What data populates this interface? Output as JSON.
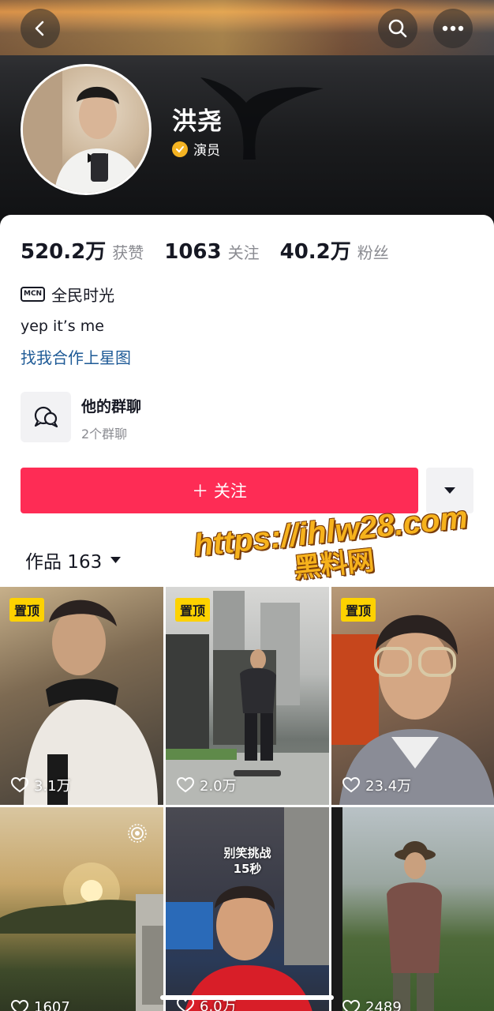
{
  "header": {
    "back_icon": "chevron-left-icon",
    "search_icon": "search-icon",
    "more_icon": "more-dots-icon",
    "name": "洪尧",
    "verify_label": "演员",
    "verify_color": "#f4b322"
  },
  "stats": [
    {
      "value": "520.2万",
      "label": "获赞"
    },
    {
      "value": "1063",
      "label": "关注"
    },
    {
      "value": "40.2万",
      "label": "粉丝"
    }
  ],
  "profile": {
    "mcn_badge": "MCN",
    "mcn_name": "全民时光",
    "bio": "yep it’s me",
    "link": "找我合作上星图"
  },
  "group_chat": {
    "title": "他的群聊",
    "subtitle": "2个群聊"
  },
  "actions": {
    "follow_label": "＋ 关注",
    "follow_color": "#fe2c55"
  },
  "works_tab": {
    "label": "作品 163"
  },
  "watermark": {
    "line1": "https://ihlw28.com",
    "line2": "黑料网"
  },
  "videos": [
    {
      "pinned": "置顶",
      "likes": "3.1万",
      "caption": ""
    },
    {
      "pinned": "置顶",
      "likes": "2.0万",
      "caption": ""
    },
    {
      "pinned": "置顶",
      "likes": "23.4万",
      "caption": ""
    },
    {
      "pinned": "",
      "likes": "1607",
      "caption": ""
    },
    {
      "pinned": "",
      "likes": "6.0万",
      "caption": "别笑挑战\n15秒"
    },
    {
      "pinned": "",
      "likes": "2489",
      "caption": ""
    }
  ]
}
